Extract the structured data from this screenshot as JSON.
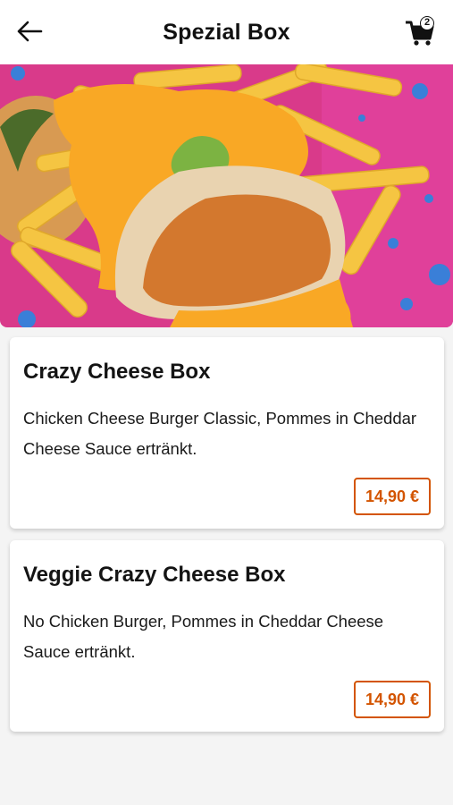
{
  "header": {
    "title": "Spezial Box",
    "cart_count": "2"
  },
  "colors": {
    "accent": "#d35400",
    "background": "#f4f4f4",
    "hero_background": "#d93a8a"
  },
  "icons": {
    "back": "arrow-left-icon",
    "cart": "shopping-cart-icon"
  },
  "products": [
    {
      "name": "Crazy Cheese Box",
      "description": "Chicken Cheese Burger Classic, Pommes in Cheddar Cheese Sauce ertränkt.",
      "price": "14,90 €"
    },
    {
      "name": "Veggie Crazy Cheese Box",
      "description": "No Chicken Burger, Pommes in Cheddar Cheese Sauce ertränkt.",
      "price": "14,90 €"
    }
  ]
}
